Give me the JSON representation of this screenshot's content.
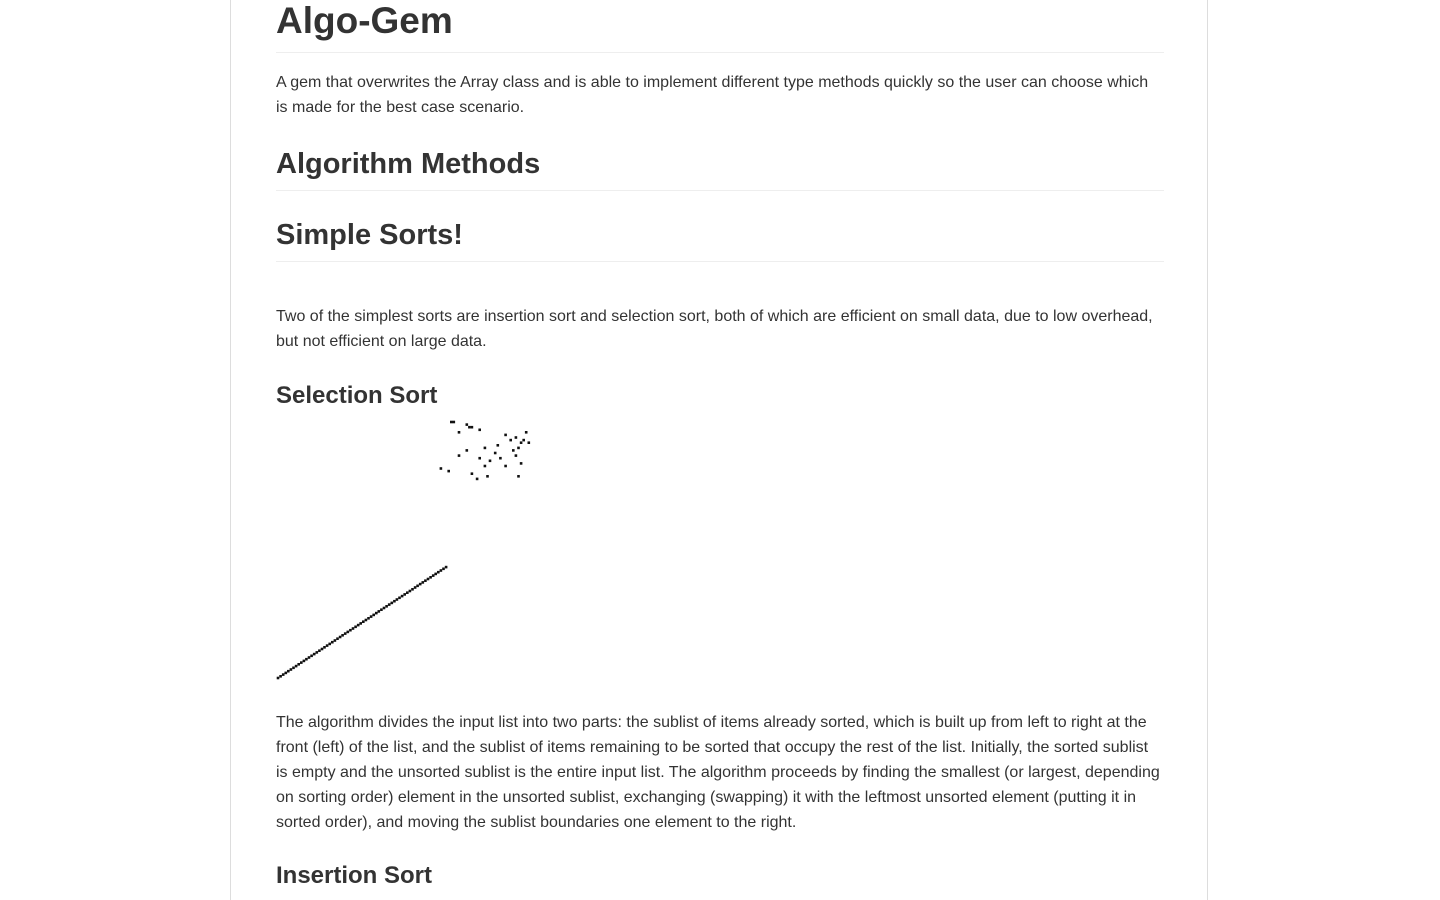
{
  "readme": {
    "title": "Algo-Gem",
    "intro": "A gem that overwrites the Array class and is able to implement different type methods quickly so the user can choose which is made for the best case scenario.",
    "algorithm_methods_heading": "Algorithm Methods",
    "simple_sorts_heading": "Simple Sorts!",
    "simple_sorts_text": "Two of the simplest sorts are insertion sort and selection sort, both of which are efficient on small data, due to low overhead, but not efficient on large data.",
    "selection_sort_heading": "Selection Sort",
    "selection_sort_text": "The algorithm divides the input list into two parts: the sublist of items already sorted, which is built up from left to right at the front (left) of the list, and the sublist of items remaining to be sorted that occupy the rest of the list. Initially, the sorted sublist is empty and the unsorted sublist is the entire input list. The algorithm proceeds by finding the smallest (or largest, depending on sorting order) element in the unsorted sublist, exchanging (swapping) it with the leftmost unsorted element (putting it in sorted order), and moving the sublist boundaries one element to the right.",
    "insertion_sort_heading": "Insertion Sort"
  },
  "selection_sort_animation": {
    "dot_color": "#111111",
    "sorted_count": 66,
    "total_count": 100,
    "unsorted_points": [
      [
        67,
        99
      ],
      [
        68,
        99
      ],
      [
        73,
        98
      ],
      [
        74,
        97
      ],
      [
        75,
        97
      ],
      [
        70,
        95
      ],
      [
        78,
        96
      ],
      [
        96,
        95
      ],
      [
        88,
        94
      ],
      [
        92,
        93
      ],
      [
        90,
        92
      ],
      [
        95,
        92
      ],
      [
        94,
        91
      ],
      [
        97,
        91
      ],
      [
        80,
        89
      ],
      [
        85,
        90
      ],
      [
        93,
        89
      ],
      [
        73,
        88
      ],
      [
        91,
        88
      ],
      [
        70,
        86
      ],
      [
        78,
        85
      ],
      [
        84,
        87
      ],
      [
        92,
        86
      ],
      [
        86,
        85
      ],
      [
        82,
        84
      ],
      [
        94,
        83
      ],
      [
        80,
        82
      ],
      [
        88,
        82
      ],
      [
        66,
        80
      ],
      [
        75,
        79
      ],
      [
        81,
        78
      ],
      [
        77,
        77
      ],
      [
        93,
        78
      ],
      [
        63,
        81
      ]
    ]
  }
}
